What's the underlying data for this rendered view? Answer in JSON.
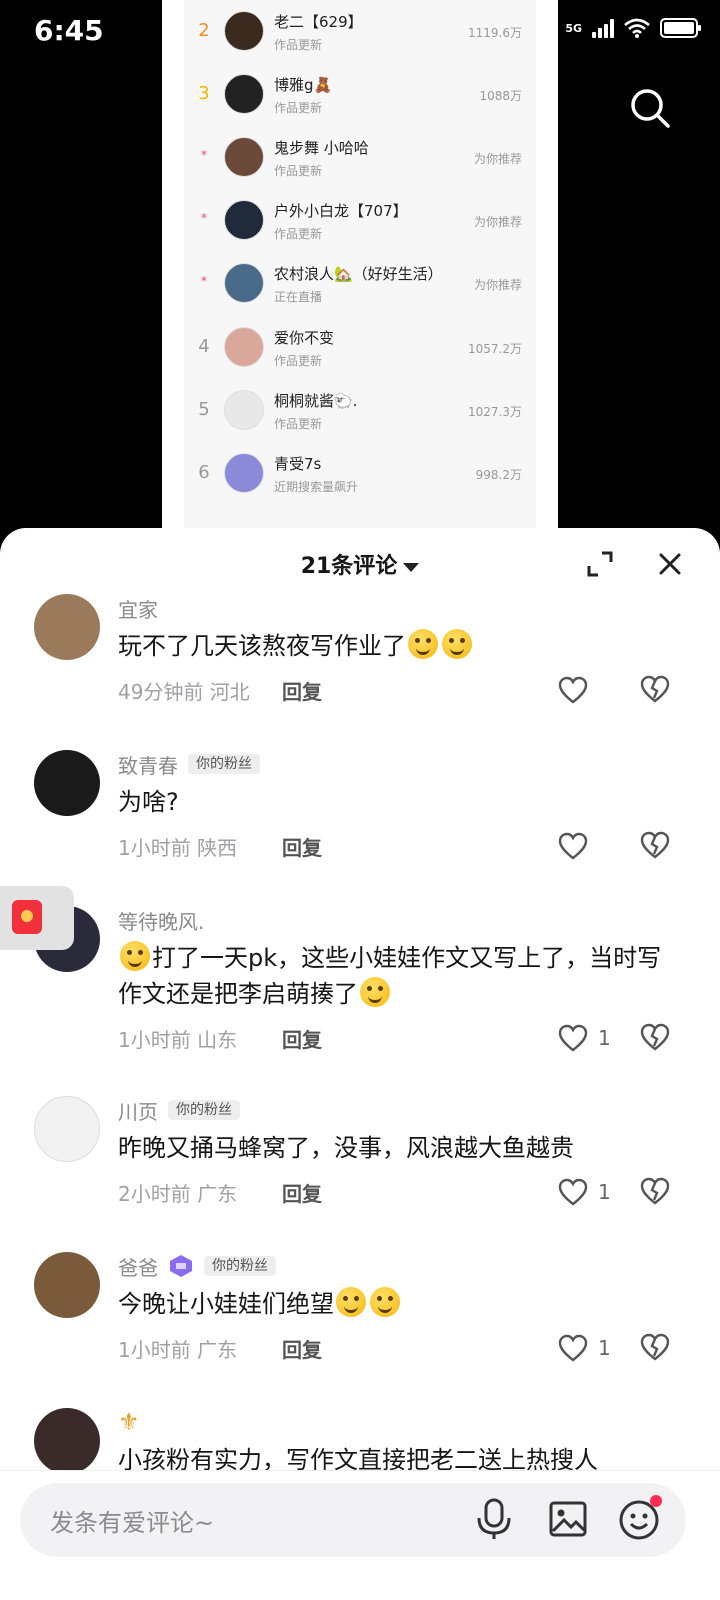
{
  "status_bar": {
    "time": "6:45",
    "network": "5G"
  },
  "ranking": [
    {
      "rank": "2",
      "name": "老二【629】",
      "sub": "作品更新",
      "value": "1119.6万",
      "rank_style": "hot-orange",
      "avatar_color": "#3a2a1e"
    },
    {
      "rank": "3",
      "name": "博雅g🧸",
      "sub": "作品更新",
      "value": "1088万",
      "rank_style": "hot-yellow",
      "avatar_color": "#222222"
    },
    {
      "rank": "*",
      "name": "鬼步舞 小哈哈",
      "sub": "作品更新",
      "value": "为你推荐",
      "rank_style": "star",
      "avatar_color": "#6b4a3a"
    },
    {
      "rank": "*",
      "name": "户外小白龙【707】",
      "sub": "作品更新",
      "value": "为你推荐",
      "rank_style": "star",
      "avatar_color": "#1f2a3a"
    },
    {
      "rank": "*",
      "name": "农村浪人🏡（好好生活）",
      "sub": "正在直播",
      "value": "为你推荐",
      "rank_style": "star",
      "avatar_color": "#4a6a8a"
    },
    {
      "rank": "4",
      "name": "爱你不变",
      "sub": "作品更新",
      "value": "1057.2万",
      "rank_style": "",
      "avatar_color": "#d9a89a"
    },
    {
      "rank": "5",
      "name": "桐桐就酱🐑.",
      "sub": "作品更新",
      "value": "1027.3万",
      "rank_style": "",
      "avatar_color": "#e8e8e8"
    },
    {
      "rank": "6",
      "name": "青受7s",
      "sub": "近期搜索量飙升",
      "value": "998.2万",
      "rank_style": "",
      "avatar_color": "#8a8ad8"
    }
  ],
  "comments_panel": {
    "title": "21条评论",
    "comments": [
      {
        "user": "宜家",
        "badge": "",
        "text": "玩不了几天该熬夜写作业了",
        "emojis_after": 2,
        "emoji_before": 0,
        "meta": "49分钟前 河北",
        "reply": "回复",
        "likes": "",
        "avatar_color": "#9a7a5a"
      },
      {
        "user": "致青春",
        "badge": "你的粉丝",
        "text": "为啥?",
        "emojis_after": 0,
        "emoji_before": 0,
        "meta": "1小时前 陕西",
        "reply": "回复",
        "likes": "",
        "avatar_color": "#1a1a1a"
      },
      {
        "user": "等待晚风.",
        "badge": "",
        "text": "打了一天pk，这些小娃娃作文又写上了，当时写作文还是把李启萌揍了",
        "emojis_after": 1,
        "emoji_before": 1,
        "meta": "1小时前 山东",
        "reply": "回复",
        "likes": "1",
        "avatar_color": "#2a2a3a"
      },
      {
        "user": "川页",
        "badge": "你的粉丝",
        "text": "昨晚又捅马蜂窝了，没事，风浪越大鱼越贵",
        "emojis_after": 0,
        "emoji_before": 0,
        "meta": "2小时前 广东",
        "reply": "回复",
        "likes": "1",
        "avatar_color": "#f2f2f2"
      },
      {
        "user": "爸爸",
        "badge": "你的粉丝",
        "text": "今晚让小娃娃们绝望",
        "emojis_after": 2,
        "emoji_before": 0,
        "meta": "1小时前 广东",
        "reply": "回复",
        "likes": "1",
        "avatar_color": "#7a5a3a",
        "level_badge": true
      },
      {
        "user": "⚜",
        "badge": "",
        "text": "小孩粉有实力，写作文直接把老二送上热搜人",
        "emojis_after": 0,
        "emoji_before": 0,
        "meta": "",
        "reply": "",
        "likes": "",
        "avatar_color": "#3a2a2a"
      }
    ]
  },
  "input_bar": {
    "placeholder": "发条有爱评论~"
  }
}
